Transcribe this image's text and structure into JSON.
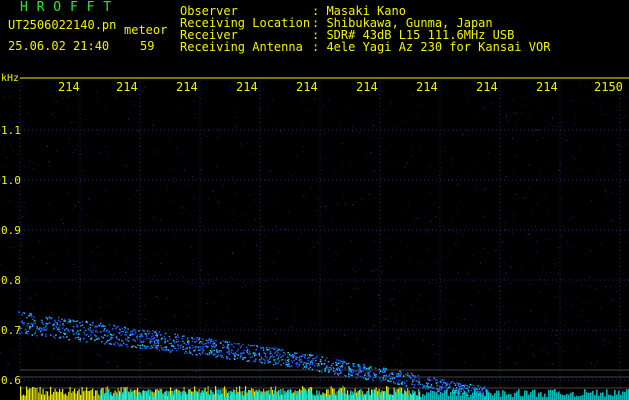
{
  "header": {
    "logo": "H R O F F T",
    "filename": "UT2506022140.pn",
    "tag": "meteor",
    "datetime": "25.06.02 21:40",
    "count": "59"
  },
  "station": [
    {
      "label": "Observer",
      "value": ": Masaki Kano"
    },
    {
      "label": "Receiving Location",
      "value": ": Shibukawa, Gunma, Japan"
    },
    {
      "label": "Receiver",
      "value": ": SDR# 43dB L15 111.6MHz USB"
    },
    {
      "label": "Receiving Antenna",
      "value": ": 4ele Yagi Az 230 for Kansai VOR"
    }
  ],
  "axis": {
    "unit": "kHz",
    "freq_labels": [
      "214",
      "214",
      "214",
      "214",
      "214",
      "214",
      "214",
      "214",
      "214",
      "2150"
    ],
    "time_labels": [
      "1.1",
      "1.0",
      "0.9",
      "0.8",
      "0.7",
      "0.6"
    ]
  },
  "colors": {
    "label": "#f2f200",
    "logo": "#2ee82e",
    "background": "#000000",
    "signal": "#1e90ff",
    "signal_hot": "#00ffff"
  }
}
